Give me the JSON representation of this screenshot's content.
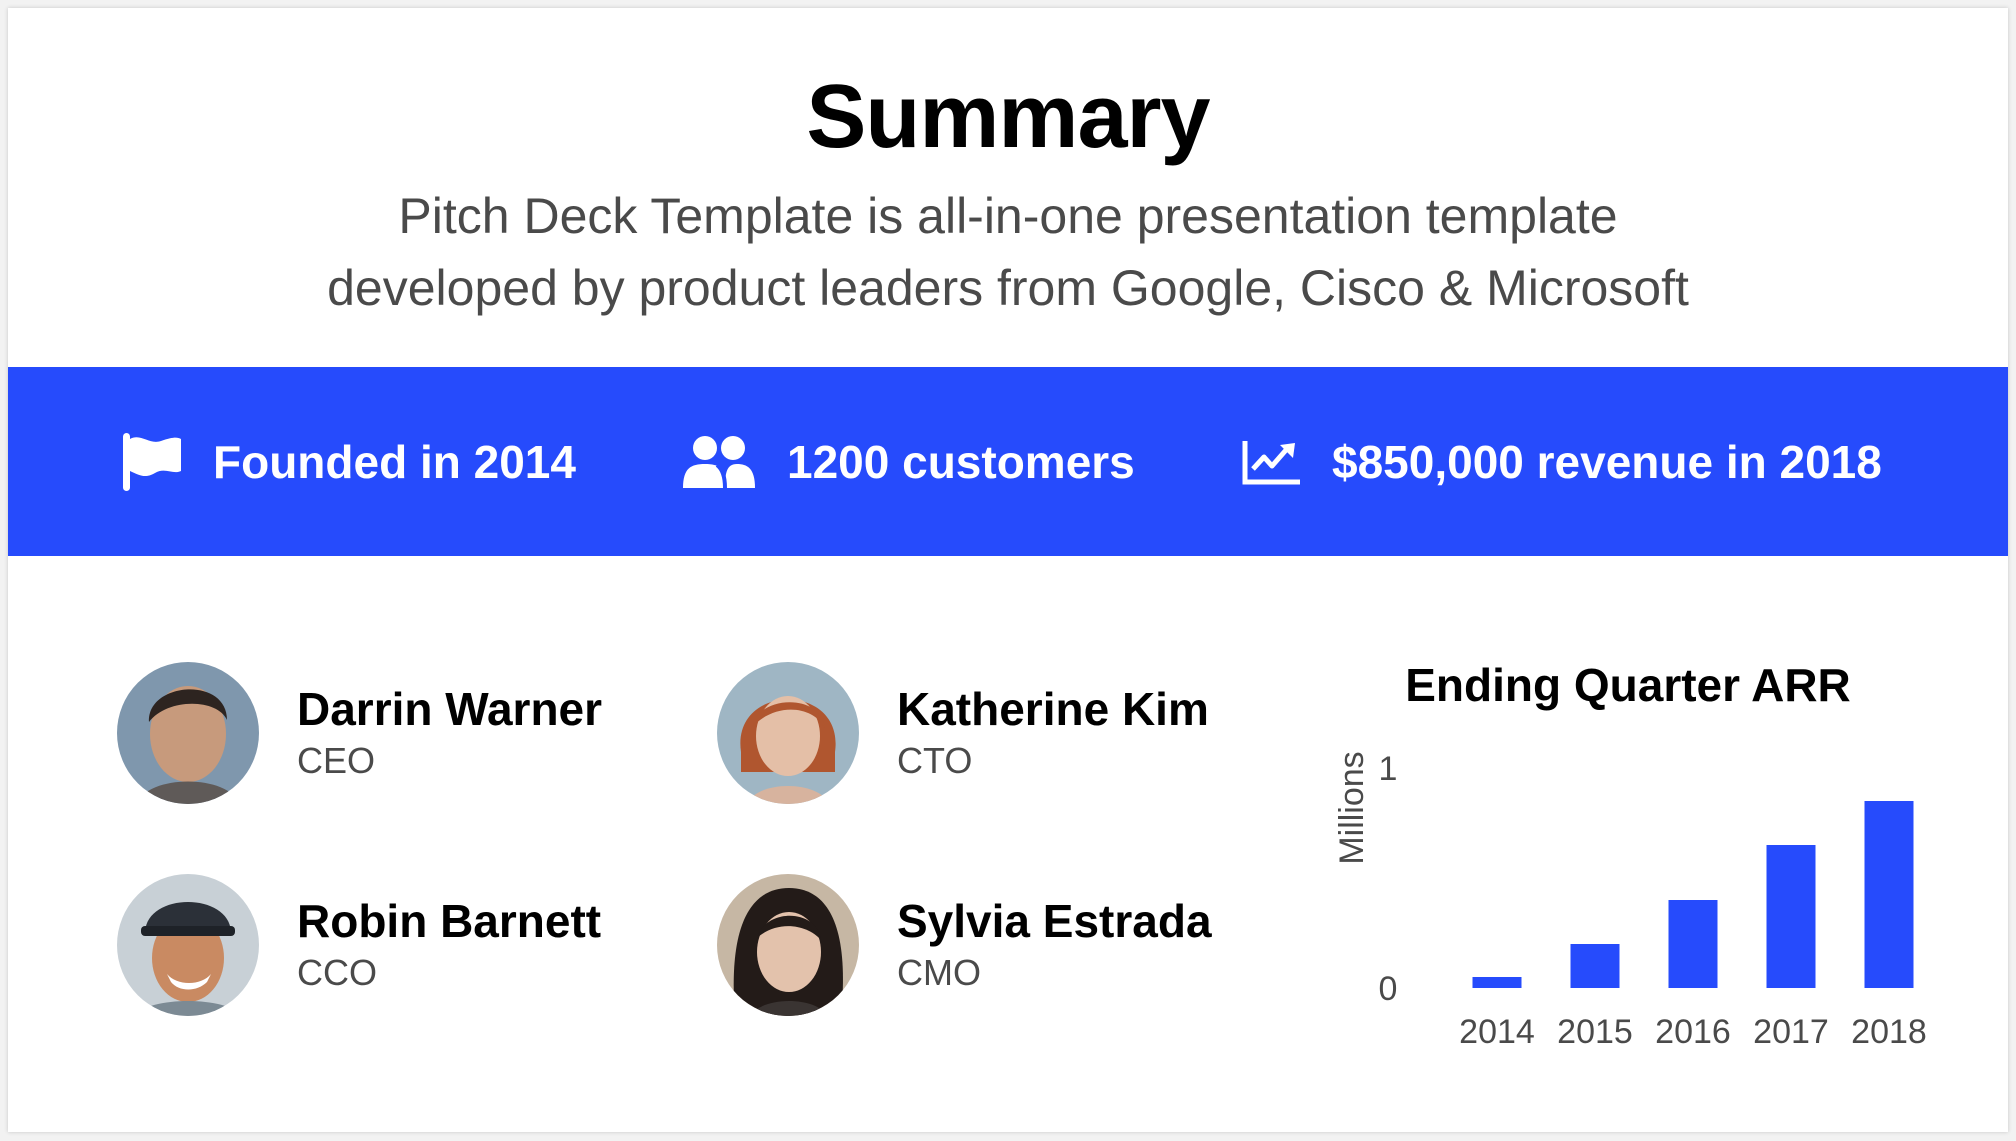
{
  "header": {
    "title": "Summary",
    "subtitle_line1": "Pitch Deck Template is all-in-one presentation template",
    "subtitle_line2": "developed by product leaders from Google, Cisco & Microsoft"
  },
  "stats": [
    {
      "icon": "flag-icon",
      "label": "Founded in 2014"
    },
    {
      "icon": "users-icon",
      "label": "1200 customers"
    },
    {
      "icon": "line-chart-icon",
      "label": "$850,000 revenue in 2018"
    }
  ],
  "colors": {
    "accent": "#264bfc",
    "text": "#000000",
    "muted": "#4a4a4a"
  },
  "team": [
    {
      "name": "Darrin Warner",
      "role": "CEO"
    },
    {
      "name": "Katherine Kim",
      "role": "CTO"
    },
    {
      "name": "Robin Barnett",
      "role": "CCO"
    },
    {
      "name": "Sylvia Estrada",
      "role": "CMO"
    }
  ],
  "chart_data": {
    "type": "bar",
    "title": "Ending Quarter ARR",
    "xlabel": "",
    "ylabel": "Millions",
    "categories": [
      "2014",
      "2015",
      "2016",
      "2017",
      "2018"
    ],
    "values": [
      0.05,
      0.2,
      0.4,
      0.65,
      0.85
    ],
    "ylim": [
      0,
      1
    ],
    "yticks": [
      "0",
      "1"
    ],
    "grid": false,
    "legend": "none",
    "color": "#264bfc"
  }
}
